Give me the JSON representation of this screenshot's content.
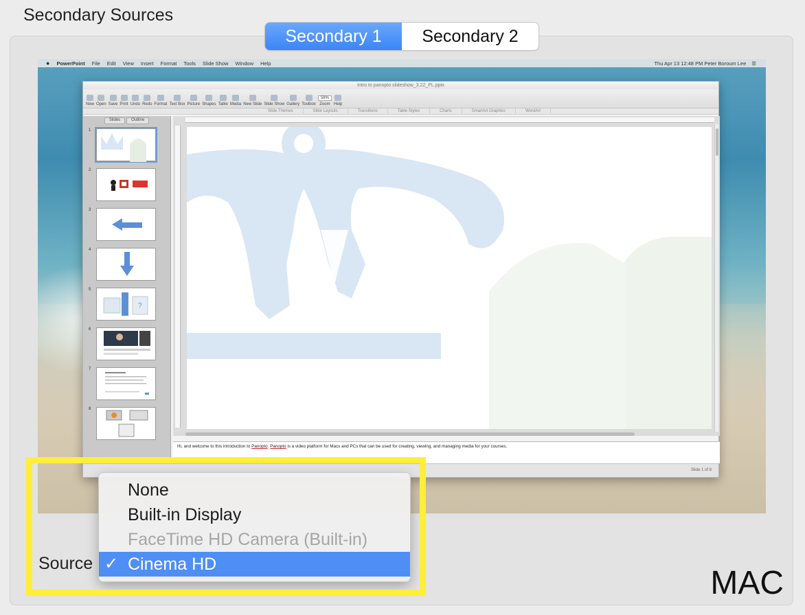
{
  "section": {
    "title": "Secondary Sources"
  },
  "tabs": [
    {
      "label": "Secondary 1",
      "active": true
    },
    {
      "label": "Secondary 2",
      "active": false
    }
  ],
  "preview": {
    "menubar": {
      "app": "PowerPoint",
      "items": [
        "File",
        "Edit",
        "View",
        "Insert",
        "Format",
        "Tools",
        "Slide Show",
        "Window",
        "Help"
      ],
      "status": "Thu Apr 13  12:48 PM   Peter Boroum Lee"
    },
    "window": {
      "title": "Intro to panopto slideshow_3.22_PL.pptx",
      "toolbar": [
        "New",
        "Open",
        "Save",
        "Print",
        "Undo",
        "Redo",
        "Format",
        "Text Box",
        "Picture",
        "Shapes",
        "Table",
        "Media",
        "New Slide",
        "Slide Show",
        "Gallery",
        "Toolbox",
        "Zoom",
        "Help"
      ],
      "zoom": "58%",
      "ribbon_tabs": [
        "Slide Themes",
        "Slide Layouts",
        "Transitions",
        "Table Styles",
        "Charts",
        "SmartArt Graphics",
        "WordArt"
      ],
      "thumb_tabs": [
        "Slides",
        "Outline"
      ],
      "slide_numbers": [
        "1",
        "2",
        "3",
        "4",
        "5",
        "6",
        "7",
        "8"
      ],
      "notes_before": "Hi, and welcome to this introduction to ",
      "notes_word1": "Panopto",
      "notes_sep": ". ",
      "notes_word2": "Panopto",
      "notes_after": " is a video platform for Macs and PCs that can be used for creating, viewing, and managing media for your courses.",
      "status": "Slide 1 of 8"
    }
  },
  "source": {
    "label": "Source",
    "options": [
      {
        "label": "None",
        "state": "normal"
      },
      {
        "label": "Built-in Display",
        "state": "normal"
      },
      {
        "label": "FaceTime HD Camera (Built-in)",
        "state": "disabled"
      },
      {
        "label": "Cinema HD",
        "state": "selected"
      }
    ],
    "check_glyph": "✓"
  },
  "platform_label": "MAC",
  "colors": {
    "accent": "#4f8ff5",
    "highlight": "#ffee3a",
    "slide_logo": "#d9e6f4"
  }
}
